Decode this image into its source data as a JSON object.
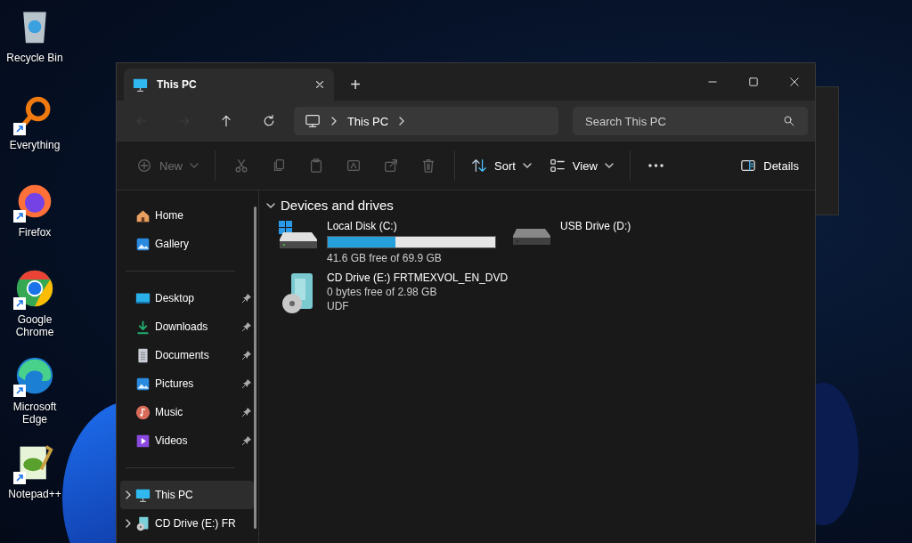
{
  "desktop_icons": [
    {
      "label": "Recycle Bin",
      "kind": "recycle",
      "shortcut": false
    },
    {
      "label": "Everything",
      "kind": "everything",
      "shortcut": true
    },
    {
      "label": "Firefox",
      "kind": "firefox",
      "shortcut": true
    },
    {
      "label": "Google Chrome",
      "kind": "chrome",
      "shortcut": true
    },
    {
      "label": "Microsoft Edge",
      "kind": "edge",
      "shortcut": true
    },
    {
      "label": "Notepad++",
      "kind": "notepad",
      "shortcut": true
    }
  ],
  "window": {
    "tabs": [
      {
        "label": "This PC",
        "selected": true
      }
    ],
    "new_tab": "+",
    "nav_buttons": [
      {
        "kind": "back",
        "disabled": true
      },
      {
        "kind": "forward",
        "disabled": true
      },
      {
        "kind": "up",
        "disabled": false
      },
      {
        "kind": "refresh",
        "disabled": false
      }
    ],
    "address": {
      "crumbs": [
        "This PC"
      ]
    },
    "search": {
      "placeholder": "Search This PC"
    },
    "toolbar": [
      {
        "kind": "new",
        "label": "New",
        "menu": true,
        "disabled": true
      },
      {
        "kind": "separator"
      },
      {
        "kind": "cut",
        "disabled": true
      },
      {
        "kind": "copy",
        "disabled": true
      },
      {
        "kind": "paste",
        "disabled": true
      },
      {
        "kind": "rename",
        "disabled": true
      },
      {
        "kind": "share",
        "disabled": true
      },
      {
        "kind": "delete",
        "disabled": true
      },
      {
        "kind": "separator"
      },
      {
        "kind": "sort",
        "label": "Sort",
        "menu": true,
        "disabled": false
      },
      {
        "kind": "view",
        "label": "View",
        "menu": true,
        "disabled": false
      },
      {
        "kind": "separator"
      },
      {
        "kind": "more",
        "disabled": false
      },
      {
        "kind": "spacer"
      },
      {
        "kind": "details",
        "label": "Details",
        "menu": false,
        "disabled": false
      }
    ],
    "sidebar": {
      "groups": [
        {
          "items": [
            {
              "label": "Home",
              "kind": "home",
              "selected": false
            },
            {
              "label": "Gallery",
              "kind": "gallery",
              "selected": false
            }
          ]
        },
        {
          "items": [
            {
              "label": "Desktop",
              "kind": "desktop",
              "pinned": true,
              "selected": false
            },
            {
              "label": "Downloads",
              "kind": "downloads",
              "pinned": true,
              "selected": false
            },
            {
              "label": "Documents",
              "kind": "documents",
              "pinned": true,
              "selected": false
            },
            {
              "label": "Pictures",
              "kind": "pictures",
              "pinned": true,
              "selected": false
            },
            {
              "label": "Music",
              "kind": "music",
              "pinned": true,
              "selected": false
            },
            {
              "label": "Videos",
              "kind": "videos",
              "pinned": true,
              "selected": false
            }
          ]
        },
        {
          "items": [
            {
              "label": "This PC",
              "kind": "pc",
              "expanded": false,
              "selected": true
            },
            {
              "label": "CD Drive (E:) FR",
              "kind": "cd",
              "expanded": false,
              "selected": false
            }
          ]
        }
      ]
    },
    "content": {
      "section": {
        "title": "Devices and drives",
        "expanded": true
      },
      "drives": [
        {
          "name": "Local Disk (C:)",
          "kind": "system",
          "level": 0.405,
          "info": [
            "41.6 GB free of 69.9 GB"
          ]
        },
        {
          "name": "USB Drive (D:)",
          "kind": "usb"
        },
        {
          "name": "CD Drive (E:) FRTMEXVOL_EN_DVD",
          "kind": "cd",
          "info": [
            "0 bytes free of 2.98 GB",
            "UDF"
          ]
        }
      ]
    }
  }
}
